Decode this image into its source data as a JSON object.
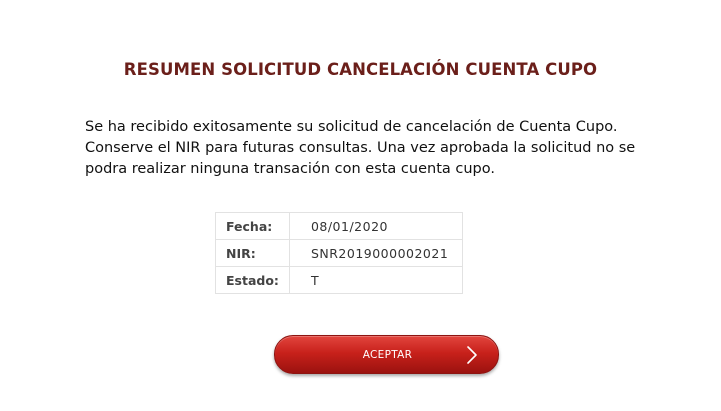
{
  "page": {
    "title": "RESUMEN SOLICITUD CANCELACIÓN CUENTA CUPO",
    "message": "Se ha recibido exitosamente su solicitud de cancelación de Cuenta Cupo. Conserve el NIR para futuras consultas. Una vez aprobada la solicitud no se podra realizar ninguna transación con esta cuenta cupo."
  },
  "details": [
    {
      "label": "Fecha:",
      "value": "08/01/2020"
    },
    {
      "label": "NIR:",
      "value": "SNR2019000002021"
    },
    {
      "label": "Estado:",
      "value": "T"
    }
  ],
  "actions": {
    "accept_label": "ACEPTAR",
    "accept_icon": "chevron-right-icon"
  },
  "colors": {
    "title": "#6b1f1a",
    "button": "#c8211b"
  }
}
